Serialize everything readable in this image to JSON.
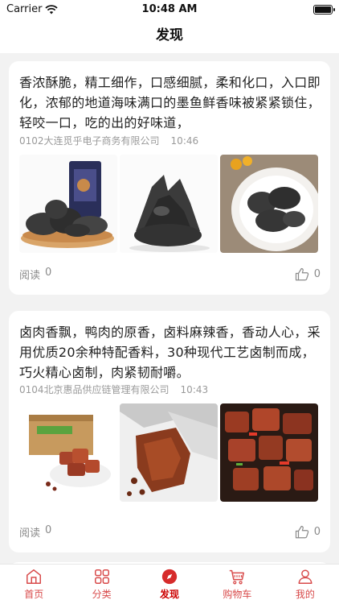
{
  "status_bar": {
    "carrier": "Carrier",
    "time": "10:48 AM"
  },
  "nav": {
    "title": "发现"
  },
  "posts": [
    {
      "text": "香浓酥脆，精工细作，口感细腻，柔和化口，入口即化，浓郁的地道海味满口的墨鱼鲜香味被紧紧锁住，轻咬一口，吃的出的好味道，",
      "company": "0102大连觅乎电子商务有限公司",
      "time": "10:46",
      "read_label": "阅读",
      "read_count": "0",
      "like_count": "0"
    },
    {
      "text": "卤肉香飘，鸭肉的原香，卤料麻辣香，香动人心，采用优质20余种特配香料，30种现代工艺卤制而成，巧火精心卤制，肉紧韧耐嚼。",
      "company": "0104北京惠品供应链管理有限公司",
      "time": "10:43",
      "read_label": "阅读",
      "read_count": "0",
      "like_count": "0"
    }
  ],
  "tabs": [
    {
      "label": "首页",
      "icon": "home-icon"
    },
    {
      "label": "分类",
      "icon": "grid-icon"
    },
    {
      "label": "发现",
      "icon": "compass-icon"
    },
    {
      "label": "购物车",
      "icon": "cart-icon"
    },
    {
      "label": "我的",
      "icon": "person-icon"
    }
  ],
  "colors": {
    "accent": "#d84a4a",
    "active": "#cc0000",
    "background": "#f2f2f2"
  }
}
